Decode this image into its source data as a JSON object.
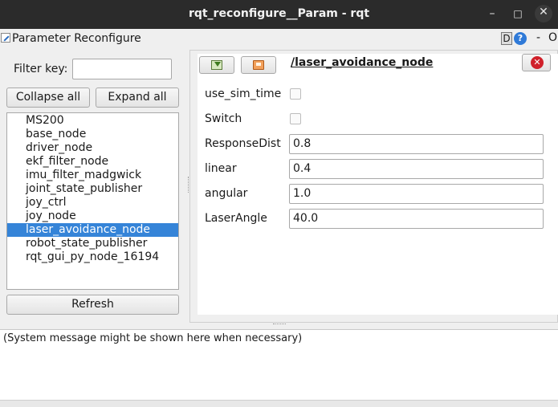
{
  "window": {
    "title": "rqt_reconfigure__Param - rqt",
    "minimize_glyph": "–",
    "maximize_glyph": "□",
    "close_glyph": "✕"
  },
  "plugin": {
    "title": "Parameter Reconfigure",
    "d_button": "D",
    "help_button": "?",
    "dash": "-",
    "o_label": "O"
  },
  "filter": {
    "label": "Filter key:",
    "value": "",
    "placeholder": ""
  },
  "buttons": {
    "collapse_all": "Collapse all",
    "expand_all": "Expand all",
    "refresh": "Refresh"
  },
  "nodes": [
    "MS200",
    "base_node",
    "driver_node",
    "ekf_filter_node",
    "imu_filter_madgwick",
    "joint_state_publisher",
    "joy_ctrl",
    "joy_node",
    "laser_avoidance_node",
    "robot_state_publisher",
    "rqt_gui_py_node_16194"
  ],
  "selected_node": "laser_avoidance_node",
  "node_panel": {
    "path": "/laser_avoidance_node",
    "load_icon": "load-icon",
    "save_icon": "save-icon",
    "close_icon": "close-icon",
    "close_glyph": "✕"
  },
  "params": {
    "use_sim_time": {
      "label": "use_sim_time",
      "checked": false
    },
    "switch": {
      "label": "Switch",
      "checked": false
    },
    "response_dist": {
      "label": "ResponseDist",
      "value": "0.8"
    },
    "linear": {
      "label": "linear",
      "value": "0.4"
    },
    "angular": {
      "label": "angular",
      "value": "1.0"
    },
    "laser_angle": {
      "label": "LaserAngle",
      "value": "40.0"
    }
  },
  "system_message": "(System message might be shown here when necessary)",
  "colors": {
    "titlebar": "#2b2b2b",
    "selection": "#3584d8",
    "close_red": "#d0202a",
    "help_blue": "#2f7ad8"
  }
}
